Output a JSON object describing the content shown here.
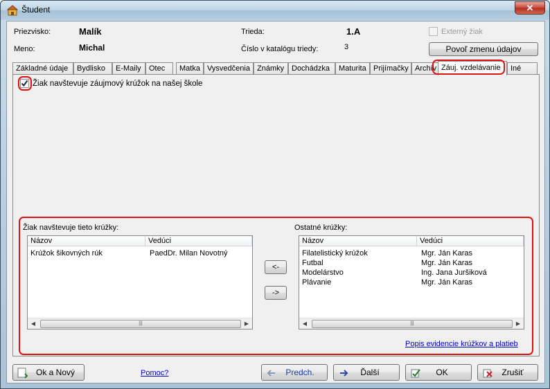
{
  "window": {
    "title": "Študent",
    "close_label": "✕"
  },
  "header": {
    "surname_label": "Priezvisko:",
    "surname_value": "Malík",
    "name_label": "Meno:",
    "name_value": "Michal",
    "class_label": "Trieda:",
    "class_value": "1.A",
    "catalog_label": "Číslo v katalógu triedy:",
    "catalog_value": "3",
    "external_label": "Externý žiak",
    "external_checked": false,
    "allow_change_label": "Povoľ zmenu údajov"
  },
  "tabs": [
    "Základné údaje",
    "Bydlisko",
    "E-Maily",
    "Otec",
    "Matka",
    "Vysvedčenia",
    "Známky",
    "Dochádzka",
    "Maturita",
    "Prijímačky",
    "Archív",
    "Záuj. vzdelávanie",
    "Iné"
  ],
  "active_tab": "Záuj. vzdelávanie",
  "interest": {
    "checkbox_label": "Žiak navštevuje záujmový krúžok na našej škole",
    "checkbox_checked": true,
    "left_title": "Žiak navštevuje tieto krúžky:",
    "right_title": "Ostatné krúžky:",
    "columns": [
      "Názov",
      "Vedúci"
    ],
    "left_rows": [
      [
        "Krúžok šikovných rúk",
        "PaedDr. Milan Novotný"
      ]
    ],
    "right_rows": [
      [
        "Filatelistický krúžok",
        "Mgr. Ján Karas"
      ],
      [
        "Futbal",
        "Mgr. Ján Karas"
      ],
      [
        "Modelárstvo",
        "Ing. Jana Juršiková"
      ],
      [
        "Plávanie",
        "Mgr. Ján Karas"
      ]
    ],
    "move_left_label": "<-",
    "move_right_label": "->",
    "link_label": "Popis evidencie krúžkov a platieb"
  },
  "footer": {
    "ok_new_label": "Ok a Nový",
    "help_label": "Pomoc?",
    "prev_label": "Predch.",
    "next_label": "Ďalší",
    "ok_label": "OK",
    "cancel_label": "Zrušiť"
  },
  "colors": {
    "highlight": "#e01010",
    "link": "#0000cc"
  }
}
